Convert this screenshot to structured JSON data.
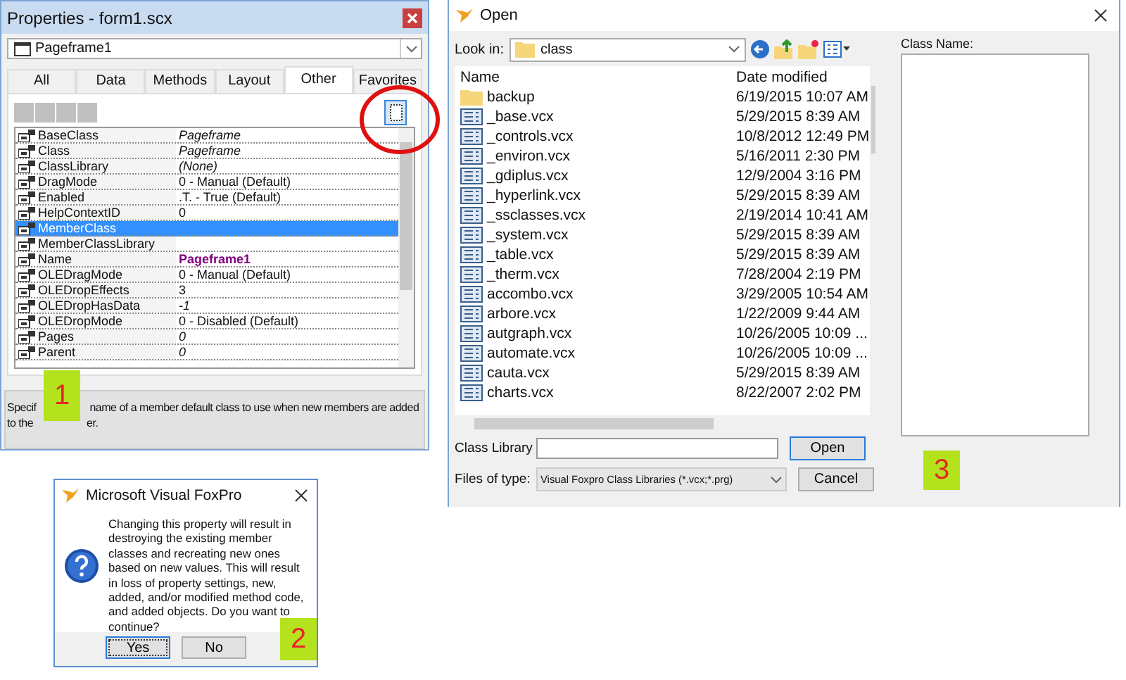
{
  "properties_window": {
    "title": "Properties - form1.scx",
    "object": "Pageframe1",
    "tabs": [
      {
        "label": "All",
        "selected": false
      },
      {
        "label": "Data",
        "selected": false
      },
      {
        "label": "Methods",
        "selected": false
      },
      {
        "label": "Layout",
        "selected": false
      },
      {
        "label": "Other",
        "selected": true
      },
      {
        "label": "Favorites",
        "selected": false
      }
    ],
    "rows": [
      {
        "name": "BaseClass",
        "value": "Pageframe",
        "kind": "readonly",
        "selected": false
      },
      {
        "name": "Class",
        "value": "Pageframe",
        "kind": "readonly",
        "selected": false
      },
      {
        "name": "ClassLibrary",
        "value": "(None)",
        "kind": "readonly",
        "selected": false
      },
      {
        "name": "DragMode",
        "value": "0 - Manual (Default)",
        "kind": "default",
        "selected": false
      },
      {
        "name": "Enabled",
        "value": ".T. - True (Default)",
        "kind": "default",
        "selected": false
      },
      {
        "name": "HelpContextID",
        "value": "0",
        "kind": "default",
        "selected": false
      },
      {
        "name": "MemberClass",
        "value": "",
        "kind": "default",
        "selected": true
      },
      {
        "name": "MemberClassLibrary",
        "value": "",
        "kind": "default",
        "selected": false
      },
      {
        "name": "Name",
        "value": "Pageframe1",
        "kind": "modified",
        "selected": false
      },
      {
        "name": "OLEDragMode",
        "value": "0 - Manual (Default)",
        "kind": "default",
        "selected": false
      },
      {
        "name": "OLEDropEffects",
        "value": "3",
        "kind": "default",
        "selected": false
      },
      {
        "name": "OLEDropHasData",
        "value": "-1",
        "kind": "readonly",
        "selected": false
      },
      {
        "name": "OLEDropMode",
        "value": "0 - Disabled (Default)",
        "kind": "default",
        "selected": false
      },
      {
        "name": "Pages",
        "value": "0",
        "kind": "readonly",
        "selected": false
      },
      {
        "name": "Parent",
        "value": "0",
        "kind": "readonly",
        "selected": false
      }
    ],
    "description_lines": [
      [
        "Specif",
        "name of a member default class to use when new members are added"
      ],
      [
        "to the",
        "er."
      ]
    ]
  },
  "message_box": {
    "title": "Microsoft Visual FoxPro",
    "message": "Changing this property will result in destroying the existing member classes and recreating new ones based on new values. This will result in loss of property settings, new, added, and/or modified method code, and added objects.  Do you want to continue?",
    "buttons": [
      {
        "label": "Yes",
        "selected": true
      },
      {
        "label": "No",
        "selected": false
      }
    ]
  },
  "open_dialog": {
    "title": "Open",
    "look_in_label": "Look in:",
    "look_in": "class",
    "columns": [
      "Name",
      "Date modified"
    ],
    "files": [
      {
        "name": "backup",
        "date": "6/19/2015 10:07 AM",
        "kind": "folder"
      },
      {
        "name": "_base.vcx",
        "date": "5/29/2015 8:39 AM",
        "kind": "library"
      },
      {
        "name": "_controls.vcx",
        "date": "10/8/2012 12:49 PM",
        "kind": "library"
      },
      {
        "name": "_environ.vcx",
        "date": "5/16/2011 2:30 PM",
        "kind": "library"
      },
      {
        "name": "_gdiplus.vcx",
        "date": "12/9/2004 3:16 PM",
        "kind": "library"
      },
      {
        "name": "_hyperlink.vcx",
        "date": "5/29/2015 8:39 AM",
        "kind": "library"
      },
      {
        "name": "_ssclasses.vcx",
        "date": "2/19/2014 10:41 AM",
        "kind": "library"
      },
      {
        "name": "_system.vcx",
        "date": "5/29/2015 8:39 AM",
        "kind": "library"
      },
      {
        "name": "_table.vcx",
        "date": "5/29/2015 8:39 AM",
        "kind": "library"
      },
      {
        "name": "_therm.vcx",
        "date": "7/28/2004 2:19 PM",
        "kind": "library"
      },
      {
        "name": "accombo.vcx",
        "date": "3/29/2005 10:54 AM",
        "kind": "library"
      },
      {
        "name": "arbore.vcx",
        "date": "1/22/2009 9:44 AM",
        "kind": "library"
      },
      {
        "name": "autgraph.vcx",
        "date": "10/26/2005 10:09 ...",
        "kind": "library"
      },
      {
        "name": "automate.vcx",
        "date": "10/26/2005 10:09 ...",
        "kind": "library"
      },
      {
        "name": "cauta.vcx",
        "date": "5/29/2015 8:39 AM",
        "kind": "library"
      },
      {
        "name": "charts.vcx",
        "date": "8/22/2007 2:02 PM",
        "kind": "library"
      }
    ],
    "class_name_label": "Class Name:",
    "class_library_label": "Class Library",
    "files_of_type_label": "Files of type:",
    "files_of_type": "Visual Foxpro Class Libraries (*.vcx;*.prg)",
    "buttons": [
      "Open",
      "Cancel"
    ]
  },
  "callouts": [
    "1",
    "2",
    "3"
  ]
}
